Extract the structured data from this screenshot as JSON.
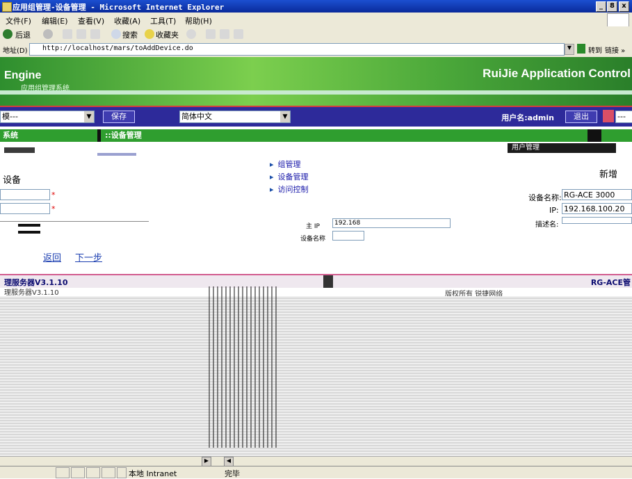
{
  "window": {
    "title": "应用组管理-设备管理 - Microsoft Internet Explorer",
    "controls": [
      "_",
      "8",
      "x"
    ]
  },
  "menu": [
    "文件(F)",
    "编辑(E)",
    "查看(V)",
    "收藏(A)",
    "工具(T)",
    "帮助(H)"
  ],
  "toolbar": {
    "back": "后退",
    "search": "搜索",
    "favorites": "收藏夹"
  },
  "address": {
    "label": "地址(D)",
    "url": "http://localhost/mars/toAddDevice.do",
    "go": "转到",
    "links": "链接 »"
  },
  "banner": {
    "engine": "Engine",
    "brand": "RuiJie Application Control",
    "sub": "应用组管理系统"
  },
  "nav": {
    "lang_select": "简体中文",
    "left_select": "模---",
    "save": "保存",
    "user_label": "用户名:admin",
    "logout": "退出",
    "right_select": "---"
  },
  "section": {
    "left_tab": "系统",
    "main_tab": "::设备管理",
    "user_manage": "用户管理"
  },
  "left_panel": {
    "title": "设备",
    "back": "返回",
    "next": "下一步"
  },
  "tree": [
    "组管理",
    "设备管理",
    "访问控制"
  ],
  "middle_form": {
    "row1_label": "主 IP",
    "row1_value": "192.168",
    "row2_label": "设备名称"
  },
  "right_form": {
    "title": "新增",
    "name_label": "设备名称:",
    "name_value": "RG-ACE 3000",
    "ip_label": "IP:",
    "ip_value": "192.168.100.20",
    "extra_label": "描述名:"
  },
  "footer": {
    "left": "理服务器V3.1.10",
    "right": "RG-ACE管",
    "sub_left": "理服务器V3.1.10",
    "sub_right": "版权所有 锐捷网络"
  },
  "status": {
    "zone": "本地 Intranet",
    "done": "完毕"
  }
}
